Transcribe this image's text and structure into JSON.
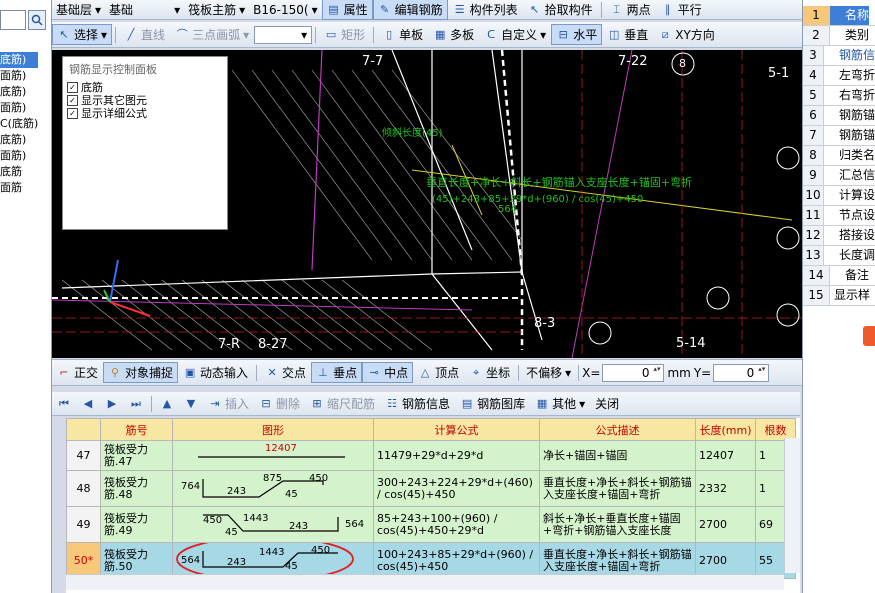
{
  "left_panel": {
    "items": [
      "底筋)",
      "面筋)",
      "底筋)",
      "面筋)",
      "C(底筋)",
      "底筋)",
      "面筋)",
      "底筋",
      "面筋"
    ],
    "selected_index": 0
  },
  "toolbar1": {
    "layer": "基础层",
    "category": "基础",
    "element_type": "筏板主筋",
    "element_name": "B16-150(",
    "properties": "属性",
    "edit_rebar": "编辑钢筋",
    "component_list": "构件列表",
    "pick_component": "拾取构件",
    "two_points": "两点",
    "parallel": "平行"
  },
  "toolbar2": {
    "select": "选择",
    "line": "直线",
    "arc": "三点画弧",
    "rect": "矩形",
    "single": "单板",
    "multi": "多板",
    "custom": "自定义",
    "horizontal": "水平",
    "vertical": "垂直",
    "xy": "XY方向"
  },
  "control_panel": {
    "title": "钢筋显示控制面板",
    "options": [
      "底筋",
      "显示其它图元",
      "显示详细公式"
    ]
  },
  "canvas_labels": {
    "axis_7_22": "7-22",
    "axis_8": "8",
    "axis_5_1": "5-1",
    "axis_5_14": "5-14",
    "axis_8_3": "8-3",
    "axis_7_r": "7-R",
    "axis_8_27": "8-27",
    "axis_7_7": "7-7",
    "green_formula": "垂直长度+净长+斜长+钢筋锚入支座长度+锚固+弯折",
    "green_calc": "(45)+243+85+29*d+(960) / cos(45)+450",
    "green_a": "倾斜长度(45)",
    "green_b": "564"
  },
  "snap_bar": {
    "ortho": "正交",
    "object_snap": "对象捕捉",
    "dynamic_input": "动态输入",
    "intersection": "交点",
    "perpendicular": "垂点",
    "midpoint": "中点",
    "vertex": "顶点",
    "coordinate": "坐标",
    "no_offset": "不偏移",
    "x_label": "X=",
    "x_value": "0",
    "x_unit": "mm",
    "y_label": "Y=",
    "y_value": "0"
  },
  "bottom_toolbar": {
    "insert": "插入",
    "delete": "删除",
    "scale_rebar": "缩尺配筋",
    "rebar_info": "钢筋信息",
    "rebar_library": "钢筋图库",
    "other": "其他",
    "close": "关闭"
  },
  "table": {
    "headers": [
      "筋号",
      "图形",
      "计算公式",
      "公式描述",
      "长度(mm)",
      "根数"
    ],
    "rows": [
      {
        "row_num": "47",
        "name": "筏板受力筋.47",
        "formula": "11479+29*d+29*d",
        "desc": "净长+锚固+锚固",
        "length": "12407",
        "count": "1",
        "shape_labels": [
          "12407"
        ]
      },
      {
        "row_num": "48",
        "name": "筏板受力筋.48",
        "formula": "300+243+224+29*d+(460) / cos(45)+450",
        "desc": "垂直长度+净长+斜长+钢筋锚入支座长度+锚固+弯折",
        "length": "2332",
        "count": "1",
        "shape_labels": [
          "764",
          "243",
          "875",
          "45",
          "450"
        ]
      },
      {
        "row_num": "49",
        "name": "筏板受力筋.49",
        "formula": "85+243+100+(960) / cos(45)+450+29*d",
        "desc": "斜长+净长+垂直长度+锚固+弯折+钢筋锚入支座长度",
        "length": "2700",
        "count": "69",
        "shape_labels": [
          "450",
          "1443",
          "45",
          "243",
          "564"
        ]
      },
      {
        "row_num": "50*",
        "name": "筏板受力筋.50",
        "formula": "100+243+85+29*d+(960) / cos(45)+450",
        "desc": "垂直长度+净长+斜长+钢筋锚入支座长度+锚固+弯折",
        "length": "2700",
        "count": "55",
        "shape_labels": [
          "564",
          "243",
          "1443",
          "45",
          "450"
        ]
      }
    ],
    "selected_row": 3
  },
  "properties_panel": {
    "rows": [
      {
        "n": "1",
        "v": "名称"
      },
      {
        "n": "2",
        "v": "类别"
      },
      {
        "n": "3",
        "v": "钢筋信"
      },
      {
        "n": "4",
        "v": "左弯折"
      },
      {
        "n": "5",
        "v": "右弯折"
      },
      {
        "n": "6",
        "v": "钢筋锚"
      },
      {
        "n": "7",
        "v": "钢筋锚"
      },
      {
        "n": "8",
        "v": "归类名"
      },
      {
        "n": "9",
        "v": "汇总信"
      },
      {
        "n": "10",
        "v": "计算设"
      },
      {
        "n": "11",
        "v": "节点设"
      },
      {
        "n": "12",
        "v": "搭接设"
      },
      {
        "n": "13",
        "v": "长度调"
      },
      {
        "n": "14",
        "v": "备注"
      },
      {
        "n": "15",
        "v": "显示样"
      }
    ]
  }
}
